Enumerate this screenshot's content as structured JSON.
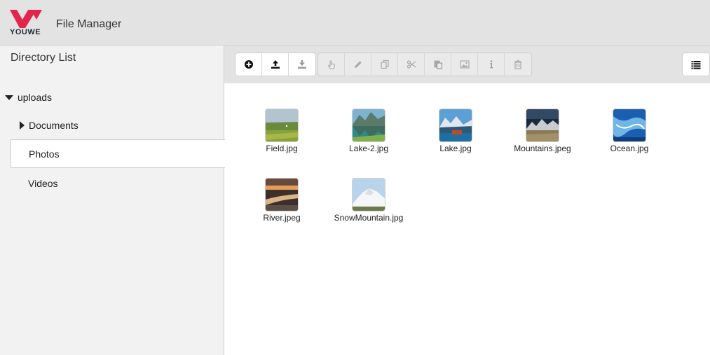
{
  "header": {
    "logo_text": "YOUWE",
    "app_title": "File Manager",
    "brand_color": "#e3254c"
  },
  "sidebar": {
    "title": "Directory List",
    "tree": {
      "root": "uploads",
      "children": [
        "Documents",
        "Photos",
        "Videos"
      ],
      "selected": "Photos"
    }
  },
  "toolbar": {
    "enabled": [
      "add-folder-icon",
      "upload-icon",
      "download-icon"
    ],
    "disabled": [
      "select-hand-icon",
      "rename-pencil-icon",
      "copy-icon",
      "cut-scissors-icon",
      "paste-icon",
      "preview-image-icon",
      "info-icon",
      "delete-trash-icon"
    ],
    "view_toggle": "list-view-icon"
  },
  "files": [
    {
      "name": "Field.jpg",
      "theme": "field"
    },
    {
      "name": "Lake-2.jpg",
      "theme": "lake2"
    },
    {
      "name": "Lake.jpg",
      "theme": "lake"
    },
    {
      "name": "Mountains.jpeg",
      "theme": "mountains"
    },
    {
      "name": "Ocean.jpg",
      "theme": "ocean"
    },
    {
      "name": "River.jpeg",
      "theme": "river"
    },
    {
      "name": "SnowMountain.jpg",
      "theme": "snow"
    }
  ]
}
